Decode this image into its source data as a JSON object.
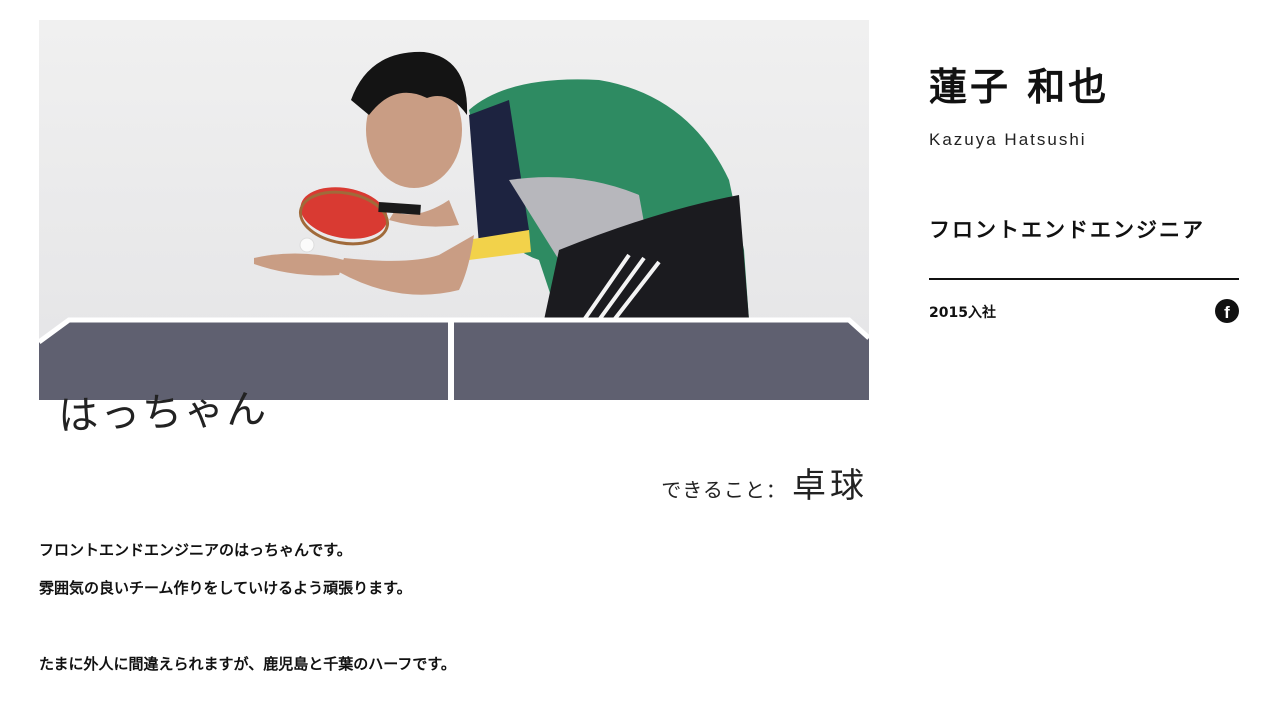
{
  "hero": {
    "nickname": "はっちゃん",
    "skill_label": "できること：",
    "skill_value": "卓球"
  },
  "description": {
    "line1": "フロントエンドエンジニアのはっちゃんです。",
    "line2": "雰囲気の良いチーム作りをしていけるよう頑張ります。",
    "line3": "たまに外人に間違えられますが、鹿児島と千葉のハーフです。"
  },
  "profile": {
    "name_ja": "蓮子 和也",
    "name_en": "Kazuya Hatsushi",
    "role": "フロントエンドエンジニア",
    "joined": "2015入社",
    "facebook_icon": "facebook-icon",
    "facebook_glyph": "f"
  },
  "colors": {
    "table": "#5f6070",
    "shirt_green": "#2e8b62",
    "paddle_red": "#d93a32",
    "text": "#111111"
  }
}
